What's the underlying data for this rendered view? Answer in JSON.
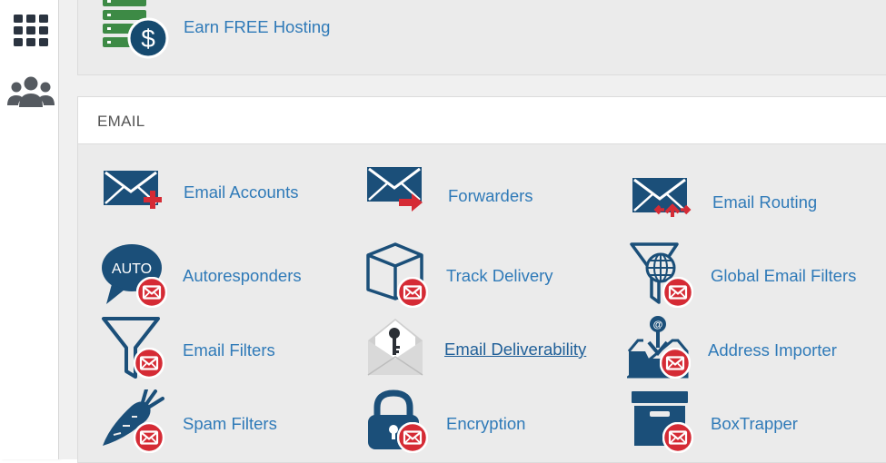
{
  "sidebar": {
    "items": [
      {
        "icon": "apps-grid-icon"
      },
      {
        "icon": "users-icon"
      }
    ]
  },
  "promo": {
    "label": "Earn FREE Hosting",
    "icon": "server-dollar-icon"
  },
  "email_section": {
    "title": "EMAIL",
    "items": [
      {
        "label": "Email Accounts",
        "icon": "envelope-plus-icon"
      },
      {
        "label": "Forwarders",
        "icon": "envelope-arrow-icon"
      },
      {
        "label": "Email Routing",
        "icon": "envelope-routing-icon"
      },
      {
        "label": "Autoresponders",
        "icon": "auto-bubble-icon",
        "badge": "AUTO"
      },
      {
        "label": "Track Delivery",
        "icon": "box-icon"
      },
      {
        "label": "Global Email Filters",
        "icon": "globe-filter-icon"
      },
      {
        "label": "Email Filters",
        "icon": "funnel-icon"
      },
      {
        "label": "Email Deliverability",
        "icon": "envelope-key-icon"
      },
      {
        "label": "Address Importer",
        "icon": "inbox-import-icon"
      },
      {
        "label": "Spam Filters",
        "icon": "carrot-icon"
      },
      {
        "label": "Encryption",
        "icon": "padlock-icon"
      },
      {
        "label": "BoxTrapper",
        "icon": "archive-box-icon"
      }
    ]
  },
  "colors": {
    "icon_navy": "#1b4f79",
    "badge_red": "#d52b35",
    "link_blue": "#2f7ab8",
    "server_green": "#3d8a45"
  }
}
